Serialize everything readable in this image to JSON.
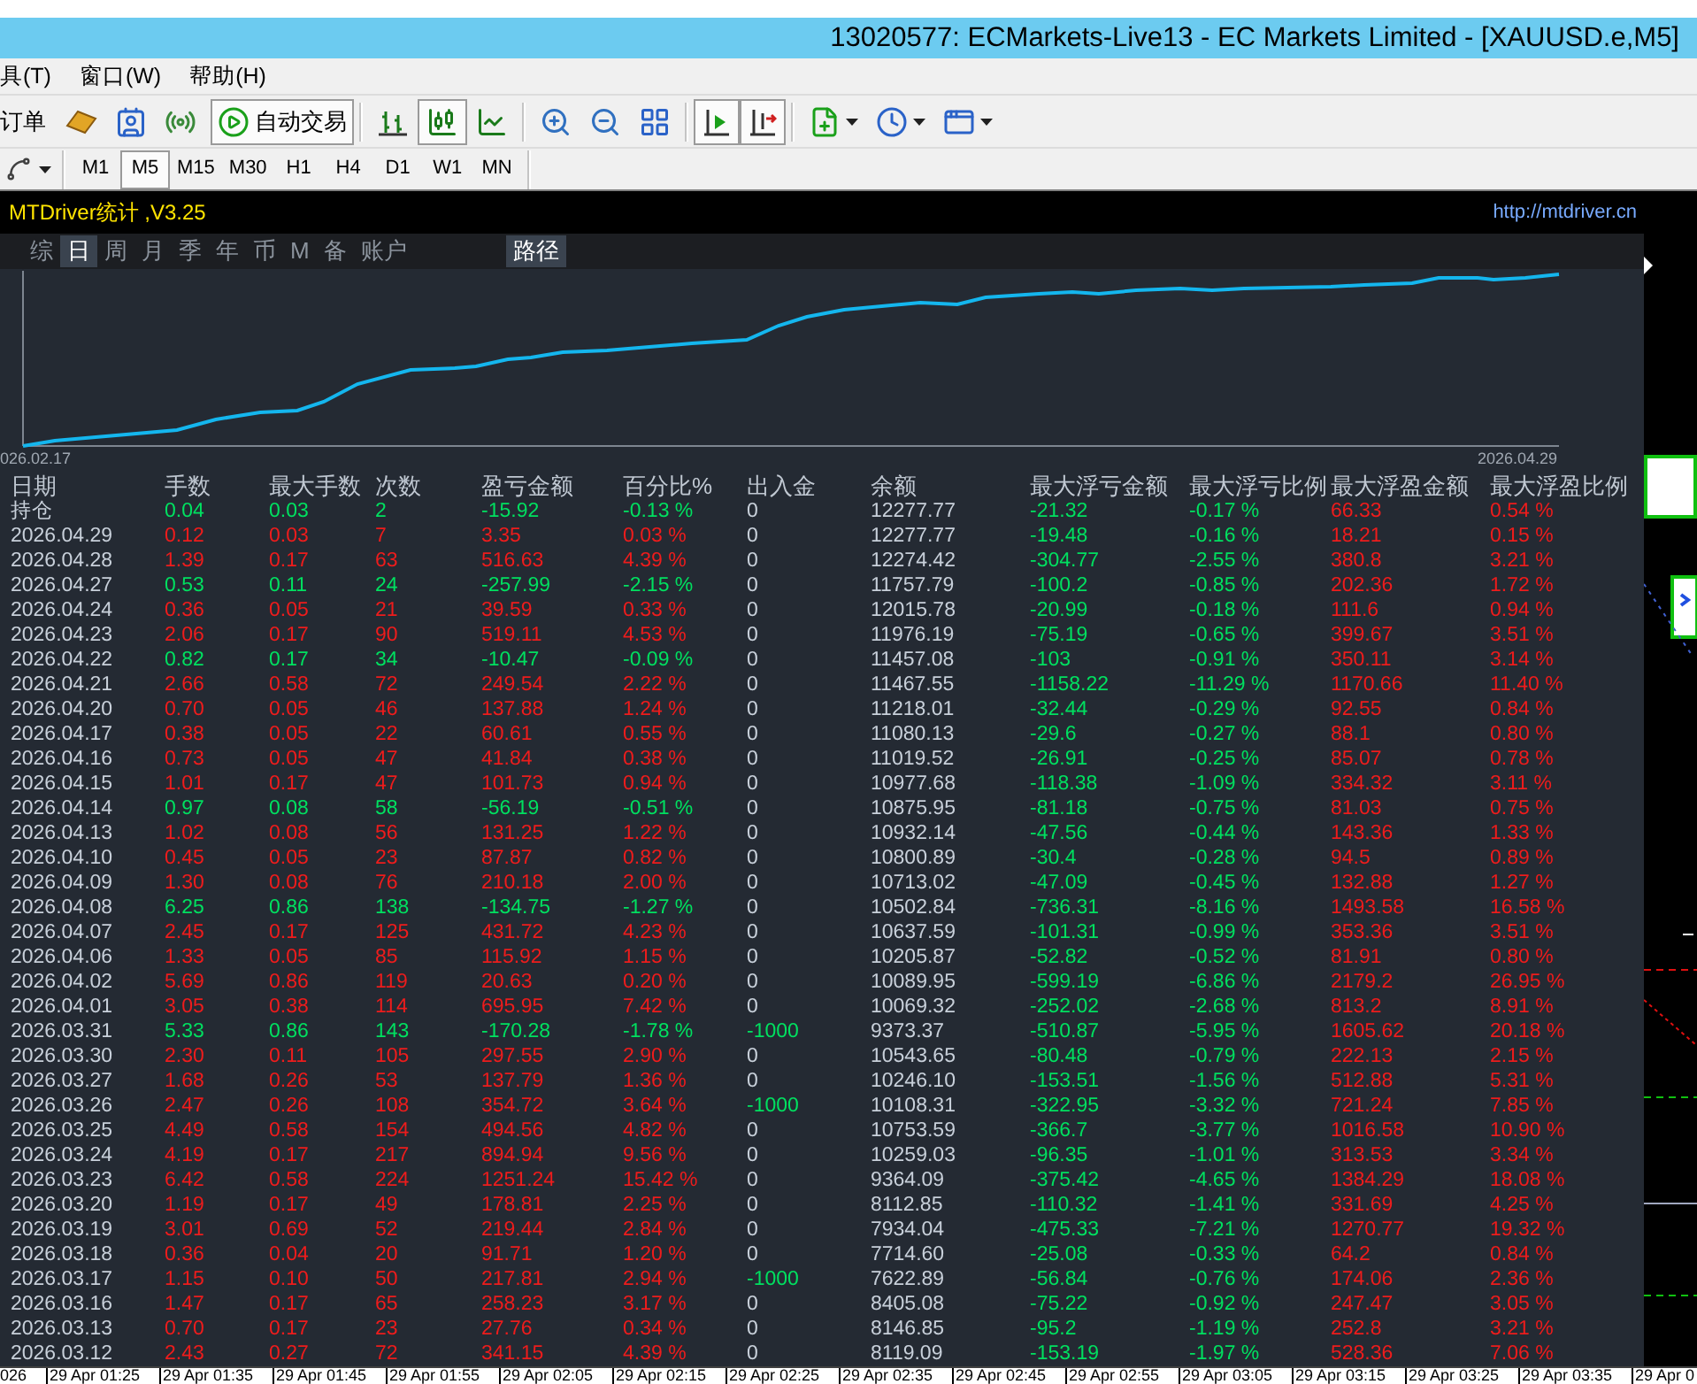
{
  "window": {
    "title": "13020577: ECMarkets-Live13 - EC Markets Limited - [XAUUSD.e,M5]"
  },
  "menu": [
    "具(T)",
    "窗口(W)",
    "帮助(H)"
  ],
  "toolbar": {
    "order_label": "订单",
    "auto_trading": {
      "label": "自动交易",
      "pressed": true
    },
    "tools": [
      {
        "pressed": false
      },
      {
        "pressed": false
      },
      {
        "pressed": false
      },
      {
        "pressed": false
      },
      {
        "pressed": true
      },
      {
        "pressed": false
      },
      {
        "pressed": false
      },
      {
        "pressed": false
      },
      {
        "pressed": false
      },
      {
        "pressed": true
      },
      {
        "pressed": true
      },
      {
        "pressed": false
      },
      {
        "pressed": false
      },
      {
        "pressed": false
      }
    ]
  },
  "timeframes": [
    {
      "label": "M1",
      "selected": false
    },
    {
      "label": "M5",
      "selected": true
    },
    {
      "label": "M15",
      "selected": false
    },
    {
      "label": "M30",
      "selected": false
    },
    {
      "label": "H1",
      "selected": false
    },
    {
      "label": "H4",
      "selected": false
    },
    {
      "label": "D1",
      "selected": false
    },
    {
      "label": "W1",
      "selected": false
    },
    {
      "label": "MN",
      "selected": false
    }
  ],
  "indicator": {
    "title": "MTDriver统计 ,V3.25",
    "link": "http://mtdriver.cn",
    "tabs": [
      {
        "label": "综",
        "selected": false
      },
      {
        "label": "日",
        "selected": true
      },
      {
        "label": "周",
        "selected": false
      },
      {
        "label": "月",
        "selected": false
      },
      {
        "label": "季",
        "selected": false
      },
      {
        "label": "年",
        "selected": false
      },
      {
        "label": "币",
        "selected": false
      },
      {
        "label": "M",
        "selected": false
      },
      {
        "label": "备",
        "selected": false
      },
      {
        "label": "账户",
        "selected": false
      }
    ],
    "path_button": {
      "label": "路径",
      "on": true
    },
    "chart": {
      "start_label": "026.02.17",
      "end_label": "2026.04.29"
    }
  },
  "table": {
    "columns": [
      {
        "label": "日期",
        "kind": "plain"
      },
      {
        "label": "手数",
        "kind": "result"
      },
      {
        "label": "最大手数",
        "kind": "result"
      },
      {
        "label": "次数",
        "kind": "result"
      },
      {
        "label": "盈亏金额",
        "kind": "result"
      },
      {
        "label": "百分比%",
        "kind": "result"
      },
      {
        "label": "出入金",
        "kind": "flow"
      },
      {
        "label": "余额",
        "kind": "plain"
      },
      {
        "label": "最大浮亏金额",
        "kind": "loss"
      },
      {
        "label": "最大浮亏比例",
        "kind": "loss"
      },
      {
        "label": "最大浮盈金额",
        "kind": "profit"
      },
      {
        "label": "最大浮盈比例",
        "kind": "profit"
      }
    ],
    "rows": [
      {
        "cells": [
          "持仓",
          "0.04",
          "0.03",
          "2",
          "-15.92",
          "-0.13 %",
          {
            "text": "0",
            "color": "#c8d0da"
          },
          "12277.77",
          "-21.32",
          "-0.17 %",
          "66.33",
          "0.54 %"
        ],
        "color": "#00e060"
      },
      {
        "cells": [
          "2026.04.29",
          "0.12",
          "0.03",
          "7",
          "3.35",
          "0.03 %",
          {
            "text": "0",
            "color": "#c8d0da"
          },
          "12277.77",
          "-19.48",
          "-0.16 %",
          "18.21",
          "0.15 %"
        ],
        "color": "#ee1c1c"
      },
      {
        "cells": [
          "2026.04.28",
          "1.39",
          "0.17",
          "63",
          "516.63",
          "4.39 %",
          {
            "text": "0",
            "color": "#c8d0da"
          },
          "12274.42",
          "-304.77",
          "-2.55 %",
          "380.8",
          "3.21 %"
        ],
        "color": "#ee1c1c"
      },
      {
        "cells": [
          "2026.04.27",
          "0.53",
          "0.11",
          "24",
          "-257.99",
          "-2.15 %",
          {
            "text": "0",
            "color": "#c8d0da"
          },
          "11757.79",
          "-100.2",
          "-0.85 %",
          "202.36",
          "1.72 %"
        ],
        "color": "#00e060"
      },
      {
        "cells": [
          "2026.04.24",
          "0.36",
          "0.05",
          "21",
          "39.59",
          "0.33 %",
          {
            "text": "0",
            "color": "#c8d0da"
          },
          "12015.78",
          "-20.99",
          "-0.18 %",
          "111.6",
          "0.94 %"
        ],
        "color": "#ee1c1c"
      },
      {
        "cells": [
          "2026.04.23",
          "2.06",
          "0.17",
          "90",
          "519.11",
          "4.53 %",
          {
            "text": "0",
            "color": "#c8d0da"
          },
          "11976.19",
          "-75.19",
          "-0.65 %",
          "399.67",
          "3.51 %"
        ],
        "color": "#ee1c1c"
      },
      {
        "cells": [
          "2026.04.22",
          "0.82",
          "0.17",
          "34",
          "-10.47",
          "-0.09 %",
          {
            "text": "0",
            "color": "#c8d0da"
          },
          "11457.08",
          "-103",
          "-0.91 %",
          "350.11",
          "3.14 %"
        ],
        "color": "#00e060"
      },
      {
        "cells": [
          "2026.04.21",
          "2.66",
          "0.58",
          "72",
          "249.54",
          "2.22 %",
          {
            "text": "0",
            "color": "#c8d0da"
          },
          "11467.55",
          "-1158.22",
          "-11.29 %",
          "1170.66",
          "11.40 %"
        ],
        "color": "#ee1c1c"
      },
      {
        "cells": [
          "2026.04.20",
          "0.70",
          "0.05",
          "46",
          "137.88",
          "1.24 %",
          {
            "text": "0",
            "color": "#c8d0da"
          },
          "11218.01",
          "-32.44",
          "-0.29 %",
          "92.55",
          "0.84 %"
        ],
        "color": "#ee1c1c"
      },
      {
        "cells": [
          "2026.04.17",
          "0.38",
          "0.05",
          "22",
          "60.61",
          "0.55 %",
          {
            "text": "0",
            "color": "#c8d0da"
          },
          "11080.13",
          "-29.6",
          "-0.27 %",
          "88.1",
          "0.80 %"
        ],
        "color": "#ee1c1c"
      },
      {
        "cells": [
          "2026.04.16",
          "0.73",
          "0.05",
          "47",
          "41.84",
          "0.38 %",
          {
            "text": "0",
            "color": "#c8d0da"
          },
          "11019.52",
          "-26.91",
          "-0.25 %",
          "85.07",
          "0.78 %"
        ],
        "color": "#ee1c1c"
      },
      {
        "cells": [
          "2026.04.15",
          "1.01",
          "0.17",
          "47",
          "101.73",
          "0.94 %",
          {
            "text": "0",
            "color": "#c8d0da"
          },
          "10977.68",
          "-118.38",
          "-1.09 %",
          "334.32",
          "3.11 %"
        ],
        "color": "#ee1c1c"
      },
      {
        "cells": [
          "2026.04.14",
          "0.97",
          "0.08",
          "58",
          "-56.19",
          "-0.51 %",
          {
            "text": "0",
            "color": "#c8d0da"
          },
          "10875.95",
          "-81.18",
          "-0.75 %",
          "81.03",
          "0.75 %"
        ],
        "color": "#00e060"
      },
      {
        "cells": [
          "2026.04.13",
          "1.02",
          "0.08",
          "56",
          "131.25",
          "1.22 %",
          {
            "text": "0",
            "color": "#c8d0da"
          },
          "10932.14",
          "-47.56",
          "-0.44 %",
          "143.36",
          "1.33 %"
        ],
        "color": "#ee1c1c"
      },
      {
        "cells": [
          "2026.04.10",
          "0.45",
          "0.05",
          "23",
          "87.87",
          "0.82 %",
          {
            "text": "0",
            "color": "#c8d0da"
          },
          "10800.89",
          "-30.4",
          "-0.28 %",
          "94.5",
          "0.89 %"
        ],
        "color": "#ee1c1c"
      },
      {
        "cells": [
          "2026.04.09",
          "1.30",
          "0.08",
          "76",
          "210.18",
          "2.00 %",
          {
            "text": "0",
            "color": "#c8d0da"
          },
          "10713.02",
          "-47.09",
          "-0.45 %",
          "132.88",
          "1.27 %"
        ],
        "color": "#ee1c1c"
      },
      {
        "cells": [
          "2026.04.08",
          "6.25",
          "0.86",
          "138",
          "-134.75",
          "-1.27 %",
          {
            "text": "0",
            "color": "#c8d0da"
          },
          "10502.84",
          "-736.31",
          "-8.16 %",
          "1493.58",
          "16.58 %"
        ],
        "color": "#00e060"
      },
      {
        "cells": [
          "2026.04.07",
          "2.45",
          "0.17",
          "125",
          "431.72",
          "4.23 %",
          {
            "text": "0",
            "color": "#c8d0da"
          },
          "10637.59",
          "-101.31",
          "-0.99 %",
          "353.36",
          "3.51 %"
        ],
        "color": "#ee1c1c"
      },
      {
        "cells": [
          "2026.04.06",
          "1.33",
          "0.05",
          "85",
          "115.92",
          "1.15 %",
          {
            "text": "0",
            "color": "#c8d0da"
          },
          "10205.87",
          "-52.82",
          "-0.52 %",
          "81.91",
          "0.80 %"
        ],
        "color": "#ee1c1c"
      },
      {
        "cells": [
          "2026.04.02",
          "5.69",
          "0.86",
          "119",
          "20.63",
          "0.20 %",
          {
            "text": "0",
            "color": "#c8d0da"
          },
          "10089.95",
          "-599.19",
          "-6.86 %",
          "2179.2",
          "26.95 %"
        ],
        "color": "#ee1c1c"
      },
      {
        "cells": [
          "2026.04.01",
          "3.05",
          "0.38",
          "114",
          "695.95",
          "7.42 %",
          {
            "text": "0",
            "color": "#c8d0da"
          },
          "10069.32",
          "-252.02",
          "-2.68 %",
          "813.2",
          "8.91 %"
        ],
        "color": "#ee1c1c"
      },
      {
        "cells": [
          "2026.03.31",
          "5.33",
          "0.86",
          "143",
          "-170.28",
          "-1.78 %",
          {
            "text": "-1000",
            "color": "#00e060"
          },
          "9373.37",
          "-510.87",
          "-5.95 %",
          "1605.62",
          "20.18 %"
        ],
        "color": "#00e060"
      },
      {
        "cells": [
          "2026.03.30",
          "2.30",
          "0.11",
          "105",
          "297.55",
          "2.90 %",
          {
            "text": "0",
            "color": "#c8d0da"
          },
          "10543.65",
          "-80.48",
          "-0.79 %",
          "222.13",
          "2.15 %"
        ],
        "color": "#ee1c1c"
      },
      {
        "cells": [
          "2026.03.27",
          "1.68",
          "0.26",
          "53",
          "137.79",
          "1.36 %",
          {
            "text": "0",
            "color": "#c8d0da"
          },
          "10246.10",
          "-153.51",
          "-1.56 %",
          "512.88",
          "5.31 %"
        ],
        "color": "#ee1c1c"
      },
      {
        "cells": [
          "2026.03.26",
          "2.47",
          "0.26",
          "108",
          "354.72",
          "3.64 %",
          {
            "text": "-1000",
            "color": "#00e060"
          },
          "10108.31",
          "-322.95",
          "-3.32 %",
          "721.24",
          "7.85 %"
        ],
        "color": "#ee1c1c"
      },
      {
        "cells": [
          "2026.03.25",
          "4.49",
          "0.58",
          "154",
          "494.56",
          "4.82 %",
          {
            "text": "0",
            "color": "#c8d0da"
          },
          "10753.59",
          "-366.7",
          "-3.77 %",
          "1016.58",
          "10.90 %"
        ],
        "color": "#ee1c1c"
      },
      {
        "cells": [
          "2026.03.24",
          "4.19",
          "0.17",
          "217",
          "894.94",
          "9.56 %",
          {
            "text": "0",
            "color": "#c8d0da"
          },
          "10259.03",
          "-96.35",
          "-1.01 %",
          "313.53",
          "3.34 %"
        ],
        "color": "#ee1c1c"
      },
      {
        "cells": [
          "2026.03.23",
          "6.42",
          "0.58",
          "224",
          "1251.24",
          "15.42 %",
          {
            "text": "0",
            "color": "#c8d0da"
          },
          "9364.09",
          "-375.42",
          "-4.65 %",
          "1384.29",
          "18.08 %"
        ],
        "color": "#ee1c1c"
      },
      {
        "cells": [
          "2026.03.20",
          "1.19",
          "0.17",
          "49",
          "178.81",
          "2.25 %",
          {
            "text": "0",
            "color": "#c8d0da"
          },
          "8112.85",
          "-110.32",
          "-1.41 %",
          "331.69",
          "4.25 %"
        ],
        "color": "#ee1c1c"
      },
      {
        "cells": [
          "2026.03.19",
          "3.01",
          "0.69",
          "52",
          "219.44",
          "2.84 %",
          {
            "text": "0",
            "color": "#c8d0da"
          },
          "7934.04",
          "-475.33",
          "-7.21 %",
          "1270.77",
          "19.32 %"
        ],
        "color": "#ee1c1c"
      },
      {
        "cells": [
          "2026.03.18",
          "0.36",
          "0.04",
          "20",
          "91.71",
          "1.20 %",
          {
            "text": "0",
            "color": "#c8d0da"
          },
          "7714.60",
          "-25.08",
          "-0.33 %",
          "64.2",
          "0.84 %"
        ],
        "color": "#ee1c1c"
      },
      {
        "cells": [
          "2026.03.17",
          "1.15",
          "0.10",
          "50",
          "217.81",
          "2.94 %",
          {
            "text": "-1000",
            "color": "#00e060"
          },
          "7622.89",
          "-56.84",
          "-0.76 %",
          "174.06",
          "2.36 %"
        ],
        "color": "#ee1c1c"
      },
      {
        "cells": [
          "2026.03.16",
          "1.47",
          "0.17",
          "65",
          "258.23",
          "3.17 %",
          {
            "text": "0",
            "color": "#c8d0da"
          },
          "8405.08",
          "-75.22",
          "-0.92 %",
          "247.47",
          "3.05 %"
        ],
        "color": "#ee1c1c"
      },
      {
        "cells": [
          "2026.03.13",
          "0.70",
          "0.17",
          "23",
          "27.76",
          "0.34 %",
          {
            "text": "0",
            "color": "#c8d0da"
          },
          "8146.85",
          "-95.2",
          "-1.19 %",
          "252.8",
          "3.21 %"
        ],
        "color": "#ee1c1c"
      },
      {
        "cells": [
          "2026.03.12",
          "2.43",
          "0.27",
          "72",
          "341.15",
          "4.39 %",
          {
            "text": "0",
            "color": "#c8d0da"
          },
          "8119.09",
          "-153.19",
          "-1.97 %",
          "528.36",
          "7.06 %"
        ],
        "color": "#ee1c1c"
      }
    ]
  },
  "time_axis": [
    "026",
    "29 Apr 01:25",
    "29 Apr 01:35",
    "29 Apr 01:45",
    "29 Apr 01:55",
    "29 Apr 02:05",
    "29 Apr 02:15",
    "29 Apr 02:25",
    "29 Apr 02:35",
    "29 Apr 02:45",
    "29 Apr 02:55",
    "29 Apr 03:05",
    "29 Apr 03:15",
    "29 Apr 03:25",
    "29 Apr 03:35",
    "29 Apr 0"
  ]
}
